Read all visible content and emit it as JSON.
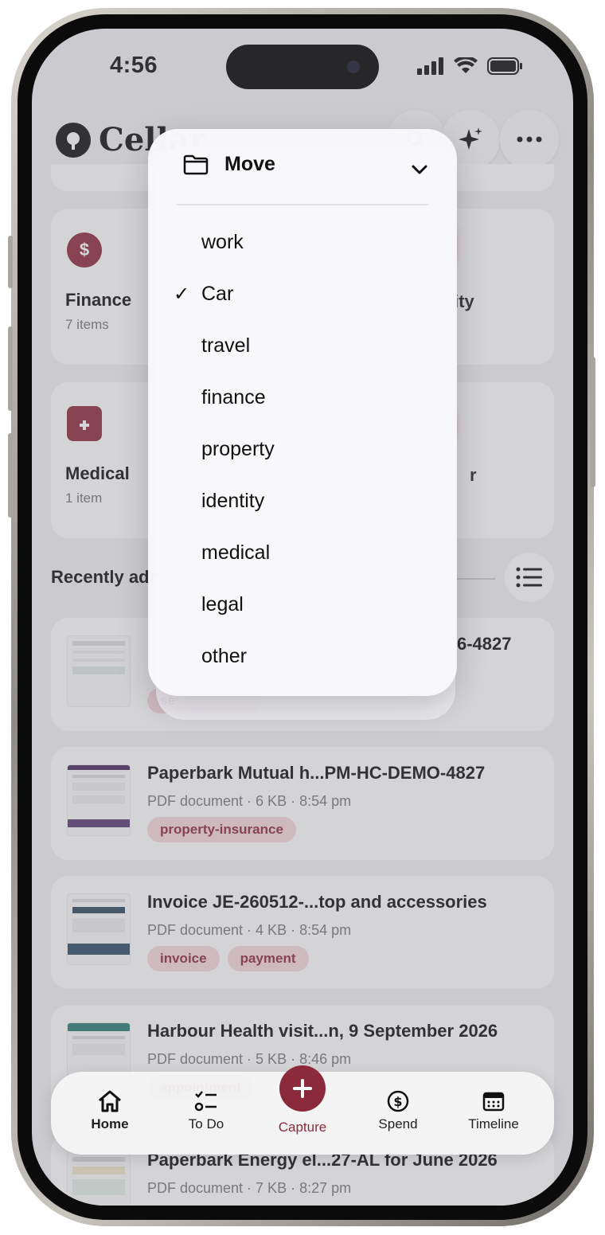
{
  "status_bar": {
    "time": "4:56"
  },
  "header": {
    "app_title": "Cellar"
  },
  "categories": [
    {
      "title": "Finance",
      "subtitle": "7 items",
      "icon": "dollar-icon"
    },
    {
      "title": "Medical",
      "subtitle": "1 item",
      "icon": "medical-kit-icon"
    }
  ],
  "blurred_labels": {
    "identity": "ity",
    "other": "r"
  },
  "recent": {
    "section_title": "Recently added",
    "partial_first_title": "6-4827",
    "partial_first_tag": "se"
  },
  "documents": [
    {
      "title": "Paperbark Mutual h...PM-HC-DEMO-4827",
      "meta": "PDF document · 6 KB · 8:54 pm",
      "tags": [
        "property-insurance"
      ]
    },
    {
      "title": "Invoice JE-260512-...top and accessories",
      "meta": "PDF document · 4 KB · 8:54 pm",
      "tags": [
        "invoice",
        "payment"
      ]
    },
    {
      "title": "Harbour Health visit...n, 9 September 2026",
      "meta": "PDF document · 5 KB · 8:46 pm",
      "tags": [
        "appointment"
      ]
    },
    {
      "title": "Paperbark Energy el...27-AL for June 2026",
      "meta": "PDF document · 7 KB · 8:27 pm",
      "tags": []
    }
  ],
  "move_menu": {
    "header_label": "Move",
    "selected": "Car",
    "items": [
      "work",
      "Car",
      "travel",
      "finance",
      "property",
      "identity",
      "medical",
      "legal",
      "other"
    ]
  },
  "tabbar": {
    "home": "Home",
    "todo": "To Do",
    "capture": "Capture",
    "spend": "Spend",
    "timeline": "Timeline"
  },
  "colors": {
    "accent": "#8b2a3b",
    "tag_bg": "#f6d7dc"
  }
}
